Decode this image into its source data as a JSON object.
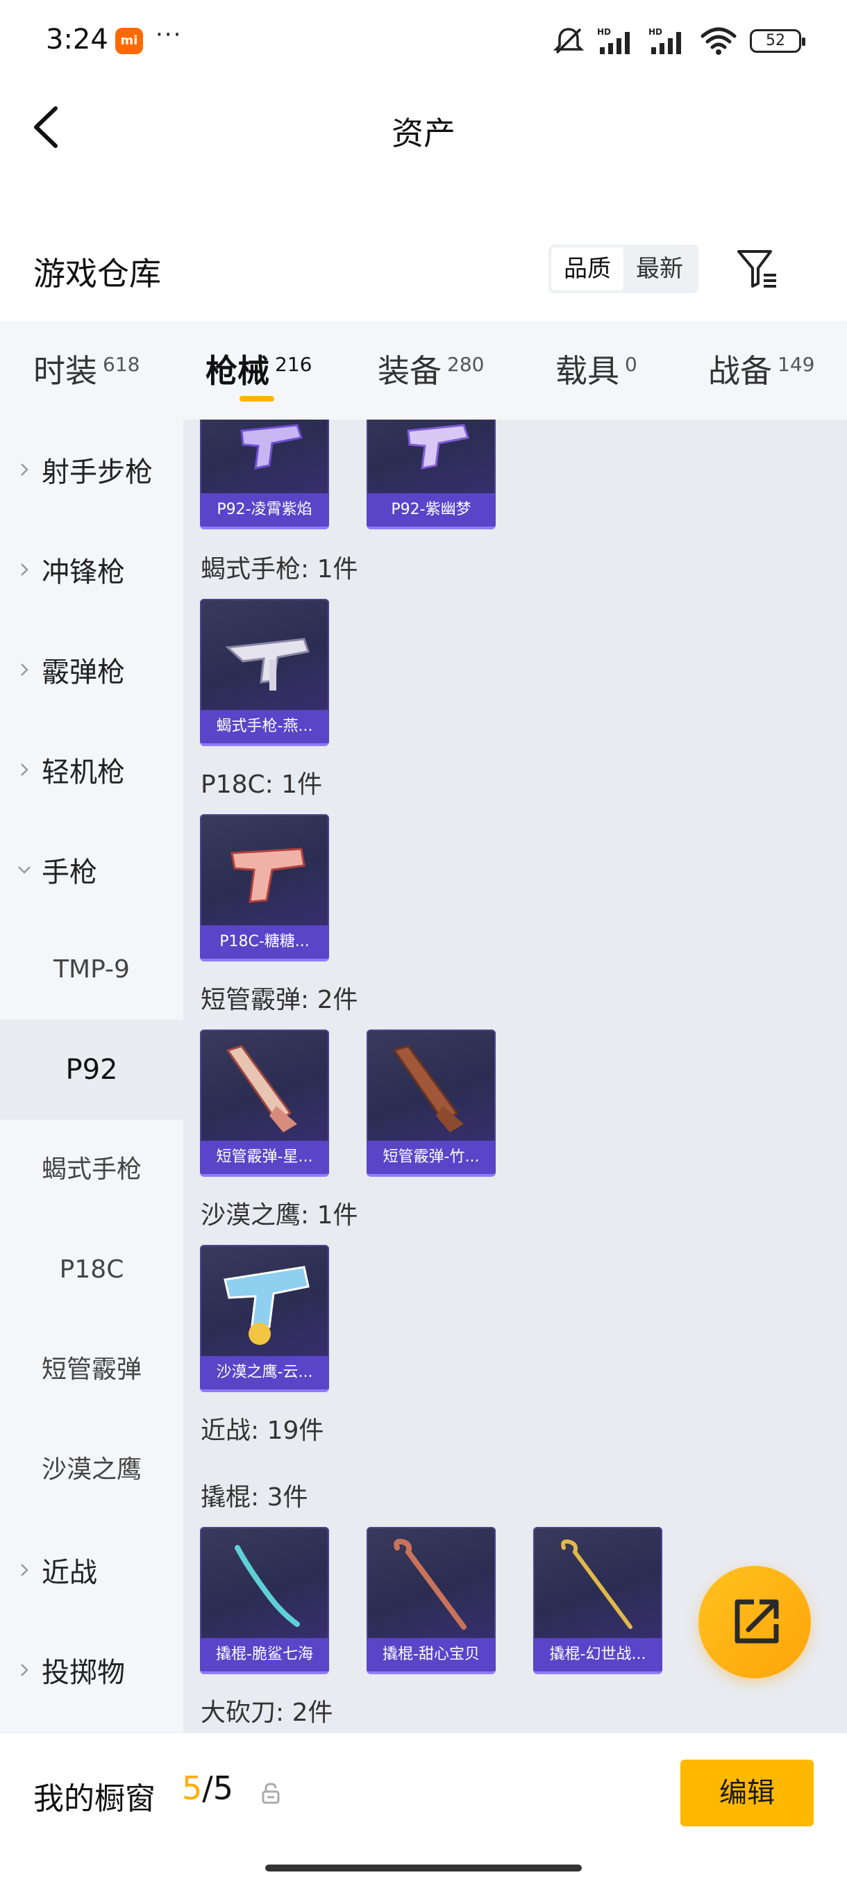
{
  "status_bar": {
    "time": "3:24",
    "mi_badge": "mi",
    "more": "···",
    "battery": "52",
    "network_label": "HD"
  },
  "header": {
    "title": "资产"
  },
  "warehouse": {
    "title": "游戏仓库",
    "sort_options": [
      "品质",
      "最新"
    ],
    "active_sort": "品质"
  },
  "tabs": [
    {
      "label": "时装",
      "count": "618"
    },
    {
      "label": "枪械",
      "count": "216",
      "active": true
    },
    {
      "label": "装备",
      "count": "280"
    },
    {
      "label": "载具",
      "count": "0"
    },
    {
      "label": "战备",
      "count": "149"
    }
  ],
  "sidebar": {
    "categories": [
      {
        "label": "射手步枪",
        "expanded": false
      },
      {
        "label": "冲锋枪",
        "expanded": false
      },
      {
        "label": "霰弹枪",
        "expanded": false
      },
      {
        "label": "轻机枪",
        "expanded": false
      },
      {
        "label": "手枪",
        "expanded": true
      },
      {
        "label": "近战",
        "expanded": false
      },
      {
        "label": "投掷物",
        "expanded": false
      }
    ],
    "subitems": [
      "TMP-9",
      "P92",
      "蝎式手枪",
      "P18C",
      "短管霰弹",
      "沙漠之鹰"
    ],
    "selected_subitem": "P92"
  },
  "content": {
    "groups": [
      {
        "label": "",
        "items": [
          "P92-凌霄紫焰",
          "P92-紫幽梦"
        ]
      },
      {
        "label": "蝎式手枪: 1件",
        "items": [
          "蝎式手枪-燕..."
        ]
      },
      {
        "label": "P18C: 1件",
        "items": [
          "P18C-糖糖..."
        ]
      },
      {
        "label": "短管霰弹: 2件",
        "items": [
          "短管霰弹-星...",
          "短管霰弹-竹..."
        ]
      },
      {
        "label": "沙漠之鹰: 1件",
        "items": [
          "沙漠之鹰-云..."
        ]
      },
      {
        "label": "近战: 19件",
        "items": []
      },
      {
        "label": "撬棍: 3件",
        "items": [
          "撬棍-脆鲨七海",
          "撬棍-甜心宝贝",
          "撬棍-幻世战..."
        ]
      },
      {
        "label": "大砍刀: 2件",
        "items": []
      }
    ]
  },
  "bottom_bar": {
    "window_label": "我的橱窗",
    "window_current": "5",
    "window_separator": "/",
    "window_total": "5",
    "edit_label": "编辑"
  },
  "colors": {
    "accent": "#ffb800",
    "card_name_bg": "#5a44c8",
    "content_bg": "#e8ebf0",
    "sidebar_bg": "#f4f7fa"
  }
}
